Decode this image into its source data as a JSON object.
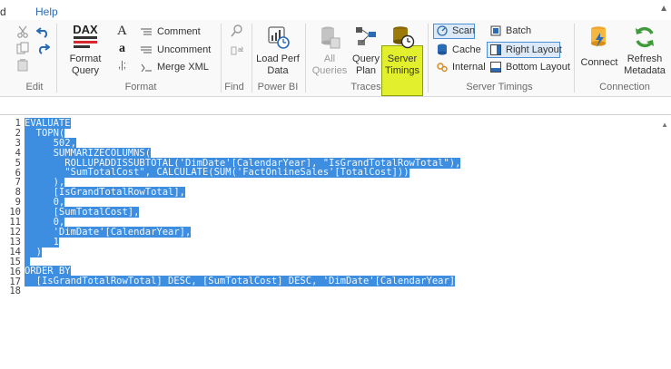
{
  "menu": {
    "partial_left": "d",
    "help": "Help"
  },
  "ribbon": {
    "edit": {
      "group": "Edit"
    },
    "format": {
      "group": "Format",
      "format_query": [
        "Format",
        "Query"
      ],
      "comment": "Comment",
      "uncomment": "Uncomment",
      "merge_xml": "Merge XML"
    },
    "find": {
      "group": "Find"
    },
    "powerbi": {
      "group": "Power BI",
      "load_perf_data": [
        "Load Perf",
        "Data"
      ]
    },
    "traces": {
      "group": "Traces",
      "all_queries": [
        "All",
        "Queries"
      ],
      "query_plan": [
        "Query",
        "Plan"
      ],
      "server_timings": [
        "Server",
        "Timings"
      ]
    },
    "server_timings": {
      "group": "Server Timings",
      "scan": "Scan",
      "cache": "Cache",
      "internal": "Internal",
      "batch": "Batch",
      "right_layout": "Right Layout",
      "bottom_layout": "Bottom Layout"
    },
    "connection": {
      "group": "Connection",
      "connect": "Connect",
      "refresh_metadata": [
        "Refresh",
        "Metadata"
      ]
    }
  },
  "editor": {
    "lines": [
      "EVALUATE",
      "  TOPN(",
      "     502,",
      "     SUMMARIZECOLUMNS(",
      "       ROLLUPADDISSUBTOTAL('DimDate'[CalendarYear], \"IsGrandTotalRowTotal\"),",
      "       \"SumTotalCost\", CALCULATE(SUM('FactOnlineSales'[TotalCost]))",
      "     ),",
      "     [IsGrandTotalRowTotal],",
      "     0,",
      "     [SumTotalCost],",
      "     0,",
      "     'DimDate'[CalendarYear],",
      "     1",
      "  )",
      "",
      "ORDER BY",
      "  [IsGrandTotalRowTotal] DESC, [SumTotalCost] DESC, 'DimDate'[CalendarYear]",
      ""
    ],
    "line_numbers": [
      "1",
      "2",
      "3",
      "4",
      "5",
      "6",
      "7",
      "8",
      "9",
      "10",
      "11",
      "12",
      "13",
      "14",
      "15",
      "16",
      "17",
      "18"
    ],
    "selection_color": "#3d8ee0"
  }
}
